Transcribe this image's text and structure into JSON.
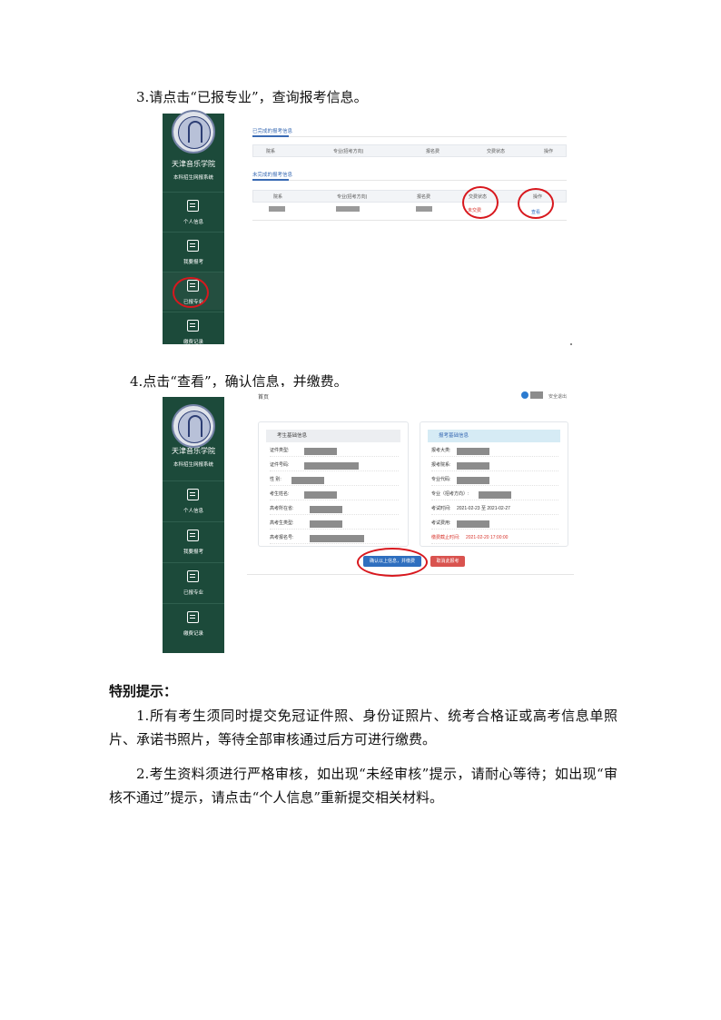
{
  "step3": {
    "title": "3.请点击“已报专业”，查询报考信息。"
  },
  "step4": {
    "title": "4.点击“查看”，确认信息，并缴费。"
  },
  "sidebar": {
    "school_name": "天津音乐学院",
    "system_name": "本科招生网报系统",
    "items": [
      {
        "label": "个人信息",
        "icon": "user-card-icon"
      },
      {
        "label": "我要报考",
        "icon": "edit-form-icon"
      },
      {
        "label": "已报专业",
        "icon": "document-icon"
      },
      {
        "label": "缴费记录",
        "icon": "record-search-icon"
      }
    ]
  },
  "screen3": {
    "section1_title": "已完成的报考信息",
    "section2_title": "未完成的报考信息",
    "headers1": [
      "院系",
      "专业(招考方向)",
      "报名费",
      "交费状态",
      "操作"
    ],
    "headers2": [
      "院系",
      "专业(招考方向)",
      "报名费",
      "交费状态",
      "操作"
    ],
    "row_status": "未交费",
    "row_action": "查看"
  },
  "screen4": {
    "breadcrumb": "首页",
    "logout": "安全退出",
    "left_box": {
      "title": "考生基础信息",
      "fields": [
        "证件类型:",
        "证件号码:",
        "性 别:",
        "考生姓名:",
        "高考所在省:",
        "高考生类型:",
        "高考报名号:"
      ]
    },
    "right_box": {
      "title": "报考基础信息",
      "fields": [
        "报考大类:",
        "报考院系:",
        "专业代码:",
        "专业（招考方向）:"
      ],
      "exam_time_label": "考试时间:",
      "exam_time_value": "2021-02-23 至 2021-02-27",
      "fee_label": "考试费用:",
      "deadline_label": "缴费截止时间:",
      "deadline_value": "2021-02-20 17:00:00"
    },
    "confirm_button": "确认以上信息，并缴费",
    "cancel_button": "取消此报考"
  },
  "notes": {
    "heading": "特别提示：",
    "p1": "1.所有考生须同时提交免冠证件照、身份证照片、统考合格证或高考信息单照片、承诺书照片，等待全部审核通过后方可进行缴费。",
    "p2": "2.考生资料须进行严格审核，如出现“未经审核”提示，请耐心等待；如出现“审核不通过”提示，请点击“个人信息”重新提交相关材料。"
  },
  "colors": {
    "sidebar_bg": "#1c4a3a",
    "accent_blue": "#3a6bb4",
    "highlight_red": "#d8181e",
    "cancel_red": "#d9534f"
  }
}
